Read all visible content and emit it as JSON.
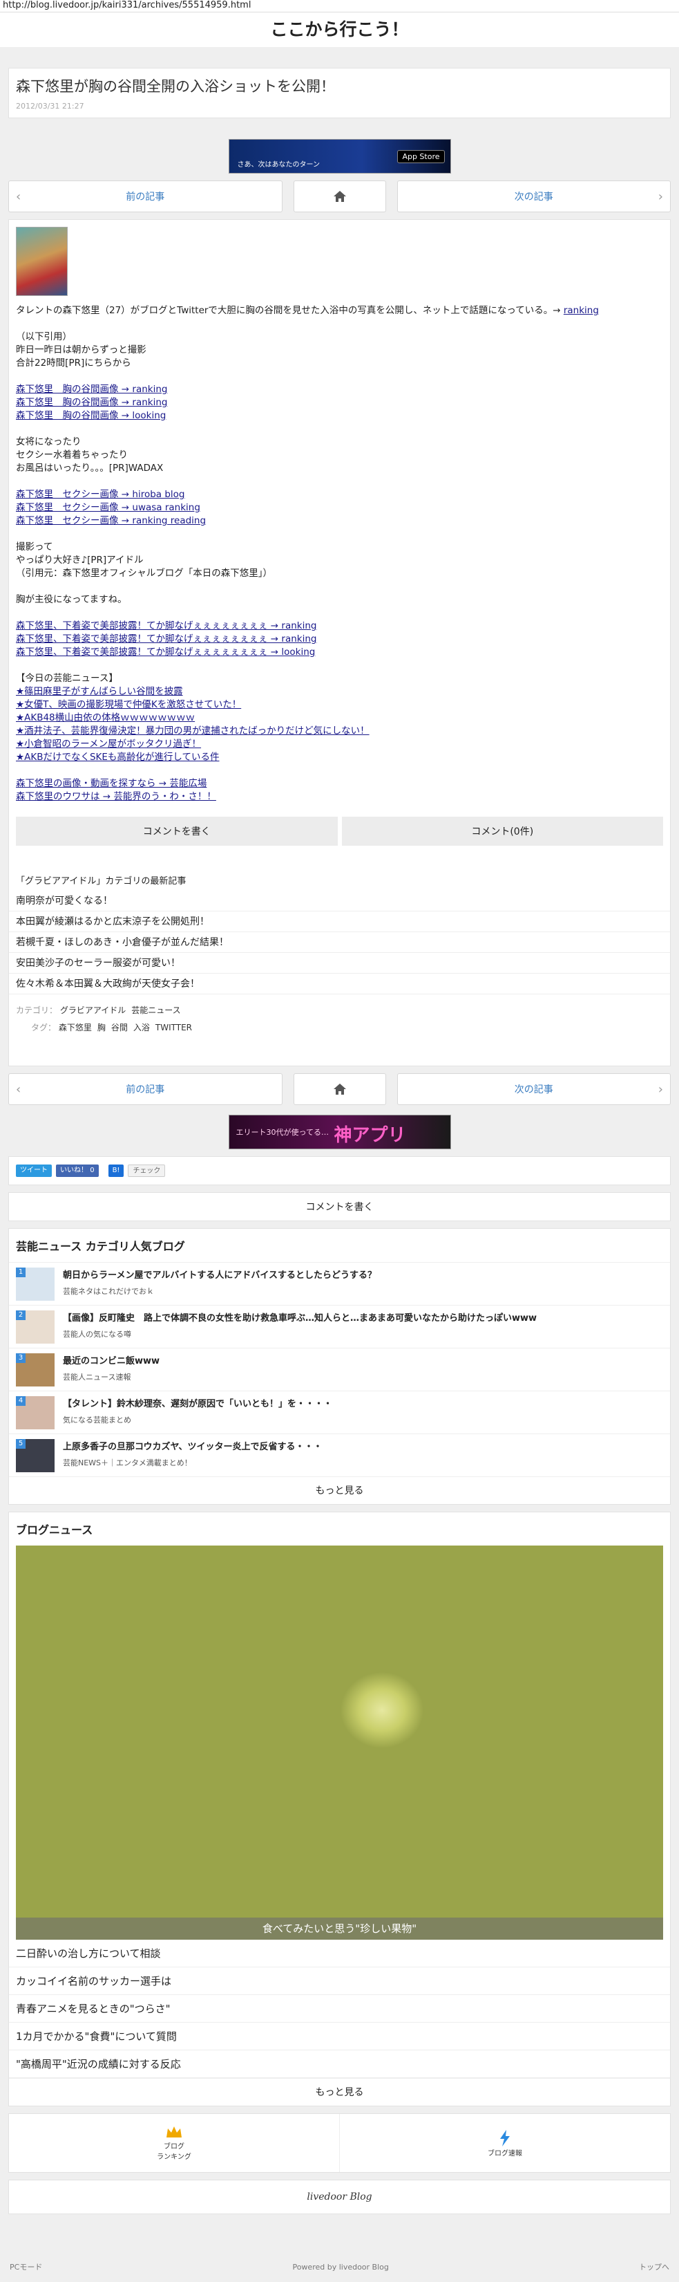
{
  "url": "http://blog.livedoor.jp/kairi331/archives/55514959.html",
  "site_title": "ここから行こう！",
  "article": {
    "title": "森下悠里が胸の谷間全開の入浴ショットを公開！",
    "date": "2012/03/31 21:27"
  },
  "banner_ad": {
    "text": "さあ、次はあなたのターン",
    "badge": "App Store"
  },
  "nav": {
    "prev": "前の記事",
    "next": "次の記事"
  },
  "body": {
    "intro": "タレントの森下悠里（27）がブログとTwitterで大胆に胸の谷間を見せた入浴中の写真を公開し、ネット上で話題になっている。→",
    "intro_link": "ranking",
    "quote": [
      "（以下引用）",
      "昨日一昨日は朝からずっと撮影",
      "合計22時間[PR]にちらから"
    ],
    "list1": [
      "森下悠里　胸の谷間画像 → ranking",
      "森下悠里　胸の谷間画像 → ranking",
      "森下悠里　胸の谷間画像 → looking"
    ],
    "quote2": [
      "女将になったり",
      "セクシー水着着ちゃったり",
      "お風呂はいったり。。。[PR]WADAX"
    ],
    "list2": [
      "森下悠里　セクシー画像 → hiroba blog",
      "森下悠里　セクシー画像 → uwasa ranking",
      "森下悠里　セクシー画像 → ranking reading"
    ],
    "quote3": [
      "撮影って",
      "やっぱり大好き♪[PR]アイドル",
      "（引用元：森下悠里オフィシャルブログ「本日の森下悠里」）"
    ],
    "line": "胸が主役になってますね。",
    "list3": [
      "森下悠里、下着姿で美部披露！てか脚なげぇぇぇぇぇぇぇぇ → ranking",
      "森下悠里、下着姿で美部披露！てか脚なげぇぇぇぇぇぇぇぇ → ranking",
      "森下悠里、下着姿で美部披露！てか脚なげぇぇぇぇぇぇぇぇ → looking"
    ],
    "news_head": "【今日の芸能ニュース】",
    "news": [
      "★篠田麻里子がすんばらしい谷間を披露",
      "★女優T、映画の撮影現場で仲優Kを激怒させていた！",
      "★AKB48横山由依の体格ｗｗｗｗｗｗｗｗ",
      "★酒井法子、芸能界復帰決定！暴力団の男が逮捕されたばっかりだけど気にしない！",
      "★小倉智昭のラーメン屋がボッタクリ過ぎ！",
      "★AKBだけでなくSKEも高齢化が進行している件"
    ],
    "tail": [
      "森下悠里の画像・動画を探すなら → 芸能広場",
      "森下悠里のウワサは → 芸能界のう・わ・さ！！"
    ]
  },
  "comment": {
    "write": "コメントを書く",
    "count": "コメント(0件)"
  },
  "category_latest": {
    "title": "「グラビアアイドル」カテゴリの最新記事",
    "items": [
      "南明奈が可愛くなる！",
      "本田翼が綾瀬はるかと広末涼子を公開処刑！",
      "若槻千夏・ほしのあき・小倉優子が並んだ結果！",
      "安田美沙子のセーラー服姿が可愛い！",
      "佐々木希＆本田翼＆大政絢が天使女子会！"
    ]
  },
  "meta": {
    "category_label": "カテゴリ：",
    "categories": [
      "グラビアアイドル",
      "芸能ニュース"
    ],
    "tag_label": "タグ：",
    "tags": [
      "森下悠里",
      "胸",
      "谷間",
      "入浴",
      "TWITTER"
    ]
  },
  "ad2": {
    "text": "エリート30代が使ってる…",
    "brand": "神アプリ"
  },
  "share": {
    "tweet": "ツイート",
    "like": "いいね！",
    "like_count": "0",
    "hatena": "B!",
    "check": "チェック"
  },
  "comment_write": "コメントを書く",
  "popular": {
    "title": "芸能ニュース カテゴリ人気ブログ",
    "items": [
      {
        "num": "1",
        "title": "朝日からラーメン屋でアルバイトする人にアドバイスするとしたらどうする？",
        "source": "芸能ネタはこれだけでおｋ"
      },
      {
        "num": "2",
        "title": "【画像】反町隆史　路上で体調不良の女性を助け救急車呼ぶ…知人らと…まあまあ可愛いなたから助けたっぽいwww",
        "source": "芸能人の気になる噂"
      },
      {
        "num": "3",
        "title": "最近のコンビニ飯www",
        "source": "芸能人ニュース速報"
      },
      {
        "num": "4",
        "title": "【タレント】鈴木紗理奈、遅刻が原因で「いいとも！」を・・・・",
        "source": "気になる芸能まとめ"
      },
      {
        "num": "5",
        "title": "上原多香子の旦那コウカズヤ、ツイッター炎上で反省する・・・",
        "source": "芸能NEWS＋｜エンタメ満載まとめ！"
      }
    ],
    "more": "もっと見る"
  },
  "blog_news": {
    "title": "ブログニュース",
    "caption": "食べてみたいと思う\"珍しい果物\"",
    "items": [
      "二日酔いの治し方について相談",
      "カッコイイ名前のサッカー選手は",
      "青春アニメを見るときの\"つらさ\"",
      "1カ月でかかる\"食費\"について質問",
      "\"高橋周平\"近況の成績に対する反応"
    ],
    "more": "もっと見る"
  },
  "bottom_nav": {
    "ranking_line1": "ブログ",
    "ranking_line2": "ランキング",
    "news": "ブログ速報"
  },
  "logo": "livedoor Blog",
  "footer": {
    "pc": "PCモード",
    "powered": "Powered by livedoor Blog",
    "top": "トップへ"
  }
}
